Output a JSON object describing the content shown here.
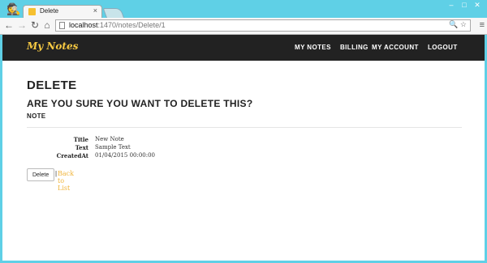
{
  "browser": {
    "tab_title": "Delete",
    "tab_close": "×",
    "url_host": "localhost",
    "url_path": ":1470/notes/Delete/1",
    "win_minimize": "–",
    "win_maximize": "□",
    "win_close": "✕"
  },
  "nav": {
    "brand": "My Notes",
    "links": [
      "MY NOTES",
      "BILLING",
      "MY ACCOUNT",
      "LOGOUT"
    ]
  },
  "page": {
    "heading": "DELETE",
    "confirm": "ARE YOU SURE YOU WANT TO DELETE THIS?",
    "entity": "NOTE",
    "fields": [
      {
        "label": "Title",
        "value": "New Note"
      },
      {
        "label": "Text",
        "value": "Sample Text"
      },
      {
        "label": "CreatedAt",
        "value": "01/04/2015 00:00:00"
      }
    ],
    "delete_button": "Delete",
    "separator": "|",
    "back_link": "Back to List"
  },
  "icons": {
    "incognito": "incognito-icon",
    "back": "back-arrow-icon",
    "forward": "forward-arrow-icon",
    "reload": "reload-icon",
    "home": "home-icon",
    "page": "page-icon",
    "search": "search-icon",
    "star": "star-icon",
    "menu": "menu-icon"
  },
  "colors": {
    "brand": "#f5c842",
    "navbar": "#222222",
    "link": "#f0b43a",
    "desktop": "#5fd0e6"
  }
}
